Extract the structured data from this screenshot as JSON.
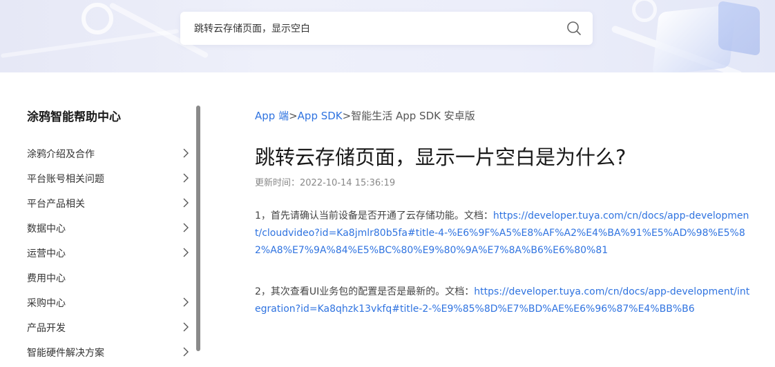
{
  "search": {
    "value": "跳转云存储页面，显示空白",
    "icon": "search-icon"
  },
  "sidebar": {
    "title": "涂鸦智能帮助中心",
    "items": [
      {
        "label": "涂鸦介绍及合作",
        "has_children": true
      },
      {
        "label": "平台账号相关问题",
        "has_children": true
      },
      {
        "label": "平台产品相关",
        "has_children": true
      },
      {
        "label": "数据中心",
        "has_children": true
      },
      {
        "label": "运营中心",
        "has_children": true
      },
      {
        "label": "费用中心",
        "has_children": false
      },
      {
        "label": "采购中心",
        "has_children": true
      },
      {
        "label": "产品开发",
        "has_children": true
      },
      {
        "label": "智能硬件解决方案",
        "has_children": true
      }
    ]
  },
  "breadcrumb": {
    "items": [
      "App 端",
      "App SDK",
      "智能生活 App SDK 安卓版"
    ],
    "separator": ">"
  },
  "article": {
    "title": "跳转云存储页面，显示一片空白是为什么?",
    "updated_label": "更新时间：",
    "updated_value": "2022-10-14 15:36:19",
    "para1_text": "1，首先请确认当前设备是否开通了云存储功能。文档：",
    "para1_link": "https://developer.tuya.com/cn/docs/app-development/cloudvideo?id=Ka8jmlr80b5fa#title-4-%E6%9F%A5%E8%AF%A2%E4%BA%91%E5%AD%98%E5%82%A8%E7%9A%84%E5%BC%80%E9%80%9A%E7%8A%B6%E6%80%81",
    "para2_text": "2，其次查看UI业务包的配置是否是最新的。文档：",
    "para2_link": "https://developer.tuya.com/cn/docs/app-development/integration?id=Ka8qhzk13vkfq#title-2-%E9%85%8D%E7%BD%AE%E6%96%87%E4%BB%B6"
  },
  "colors": {
    "link": "#2f73e0",
    "hero_bg": "#e8ebf8"
  }
}
